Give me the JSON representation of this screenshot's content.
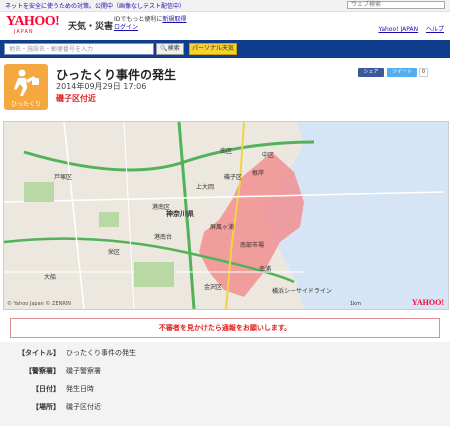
{
  "promo": {
    "text": "ネットを安全に使うための対策。公開中（画像なしテスト配信中）"
  },
  "header": {
    "search_placeholder": "ウェブ検索",
    "logo": "YAHOO!",
    "logo_sub": "JAPAN",
    "service": "天気・災害",
    "login_text": "IDでもっと便利に",
    "signup_link": "新規取得",
    "login_link": "ログイン",
    "links": [
      "Yahoo! JAPAN",
      "ヘルプ"
    ]
  },
  "searchbar": {
    "placeholder": "地名・施設名・郵便番号を入力",
    "search_button": "検索",
    "personal_button": "パーソナル天気"
  },
  "incident": {
    "icon": "thief-icon",
    "icon_label": "ひったくり",
    "title": "ひったくり事件の発生",
    "datetime": "2014年09月29日 17:06",
    "place": "磯子区付近",
    "share_fb": "シェア",
    "share_tw": "ツイート",
    "tweet_count": "0"
  },
  "map": {
    "labels": [
      "中区",
      "南区",
      "港南区",
      "磯子区",
      "金沢区",
      "栄区",
      "戸塚区",
      "神奈川県",
      "大船",
      "上大岡",
      "根岸",
      "幸浦",
      "屏風ヶ浦",
      "港南台",
      "南部市場",
      "横浜シーサイドライン"
    ],
    "copyright": "© Yahoo Japan © ZENRIN",
    "scale": "1km",
    "logo": "YAHOO!"
  },
  "notice": "不審者を見かけたら通報をお願いします。",
  "details": [
    {
      "key": "【タイトル】",
      "value": "ひったくり事件の発生"
    },
    {
      "key": "【警察署】",
      "value": "磯子警察署"
    },
    {
      "key": "【日付】",
      "value": "発生日時"
    },
    {
      "key": "【場所】",
      "value": "磯子区付近"
    }
  ],
  "colors": {
    "brand": "#ff0033",
    "nav": "#103d8c",
    "area": "#f28a8a",
    "sea": "#d5e5f5",
    "alert": "#e02020"
  }
}
